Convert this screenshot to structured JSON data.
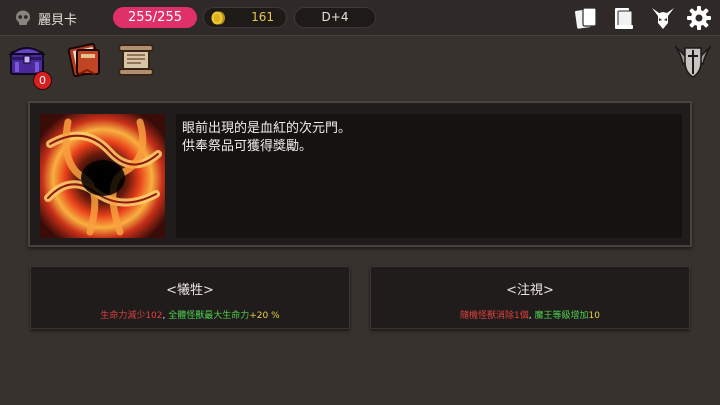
{
  "topbar": {
    "character_name": "麗貝卡",
    "hp": "255/255",
    "gold": "161",
    "day": "D+4"
  },
  "inventory": {
    "chest_count": "0"
  },
  "event": {
    "lines": [
      "眼前出現的是血紅的次元門。",
      "供奉祭品可獲得獎勵。"
    ]
  },
  "choices": [
    {
      "title": "<犧牲>",
      "desc_parts": [
        {
          "text": "生命力減少102",
          "color": "#e04040"
        },
        {
          "text": ", ",
          "color": "#e8e2dc"
        },
        {
          "text": "全體怪獸最大生命力",
          "color": "#4ed04e"
        },
        {
          "text": "+20 %",
          "color": "#e8d040"
        }
      ]
    },
    {
      "title": "<注視>",
      "desc_parts": [
        {
          "text": "隨機怪獸消除1個",
          "color": "#e04040"
        },
        {
          "text": ", ",
          "color": "#e8e2dc"
        },
        {
          "text": "魔王等級增加",
          "color": "#4ed04e"
        },
        {
          "text": "10",
          "color": "#e8d040"
        }
      ]
    }
  ],
  "icons": {
    "character": "skull-icon",
    "gold": "coin-icon",
    "top_right": [
      "cards-icon",
      "book-icon",
      "demon-horns-icon",
      "gear-icon"
    ],
    "inventory": [
      "chest-icon",
      "spellbook-icon",
      "scroll-icon"
    ],
    "guild": "winged-shield-icon"
  },
  "colors": {
    "hp_pill": "#e0306a",
    "gold_text": "#e8c84a",
    "badge": "#d82020"
  }
}
